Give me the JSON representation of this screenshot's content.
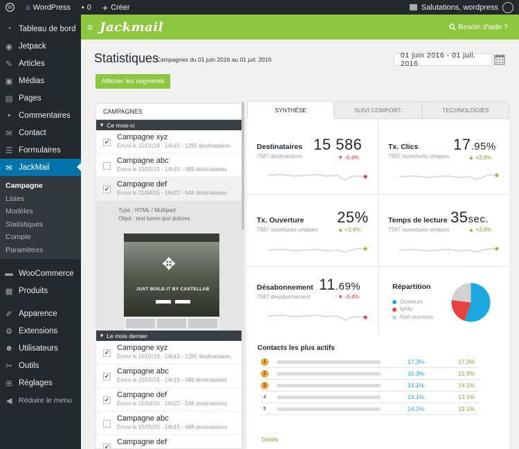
{
  "adminbar": {
    "site": "WordPress",
    "comments": "0",
    "new": "Créer",
    "greeting": "Salutations, wordpress"
  },
  "sidebar": {
    "items": [
      {
        "label": "Tableau de bord",
        "icon": "dashboard-icon"
      },
      {
        "label": "Jetpack",
        "icon": "jetpack-icon"
      },
      {
        "label": "Articles",
        "icon": "pin-icon"
      },
      {
        "label": "Médias",
        "icon": "media-icon"
      },
      {
        "label": "Pages",
        "icon": "pages-icon"
      },
      {
        "label": "Commentaires",
        "icon": "comments-icon"
      },
      {
        "label": "Contact",
        "icon": "mail-icon"
      },
      {
        "label": "Formulaires",
        "icon": "forms-icon"
      },
      {
        "label": "JackMail",
        "icon": "envelope-icon"
      }
    ],
    "submenu": [
      "Campagne",
      "Listes",
      "Modèles",
      "Statistiques",
      "Compte",
      "Paramètres"
    ],
    "items2": [
      {
        "label": "WooCommerce",
        "icon": "woo-icon"
      },
      {
        "label": "Produits",
        "icon": "products-icon"
      }
    ],
    "items3": [
      {
        "label": "Apparence",
        "icon": "brush-icon"
      },
      {
        "label": "Extensions",
        "icon": "plugin-icon"
      },
      {
        "label": "Utilisateurs",
        "icon": "users-icon"
      },
      {
        "label": "Outils",
        "icon": "wrench-icon"
      },
      {
        "label": "Réglages",
        "icon": "settings-icon"
      },
      {
        "label": "Réduire le menu",
        "icon": "collapse-icon"
      }
    ]
  },
  "topbar": {
    "logo": "Jackmail",
    "help": "Besoin d'aide ?"
  },
  "header": {
    "title": "Statistiques",
    "subtitle": "Campagnes du 01 juin 2016 au 01 juil. 2016",
    "date_range": "01 juin 2016 - 01 juil. 2016",
    "segments_button": "Afficher les segments"
  },
  "campaigns": {
    "heading": "CAMPAGNES",
    "group1": "Ce mois-ci",
    "group2": "Le mois dernier",
    "rows1": [
      {
        "name": "Campagne xyz",
        "info": "Envoi le 15/01/16 - 14h15 - 1265 destinataires",
        "checked": "✔"
      },
      {
        "name": "Campagne abc",
        "info": "Envoi le 15/05/15 - 14h15 - 488 destinataires",
        "checked": ""
      },
      {
        "name": "Campagne def",
        "info": "Envoi le 21/04/15 - 16h22 - 548 destinataires",
        "checked": "✔"
      }
    ],
    "detail": {
      "type": "Type : HTML / Multipart",
      "objet": "Objet : test lorem ipsl dolores",
      "preview_text": "JUST BUILD IT BY CASTELLAB"
    },
    "rows2": [
      {
        "name": "Campagne xyz",
        "info": "Envoi le 15/01/16 - 14h15 - 1265 destinataires",
        "checked": "✔"
      },
      {
        "name": "Campagne abc",
        "info": "Envoi le 15/05/15 - 14h15 - 488 destinataires",
        "checked": "✔"
      },
      {
        "name": "Campagne def",
        "info": "Envoi le 21/04/15 - 16h22 - 548 destinataires",
        "checked": "✔"
      },
      {
        "name": "Campagne abc",
        "info": "Envoi le 15/05/15 - 14h15 - 488 destinataires",
        "checked": ""
      },
      {
        "name": "Campagne def",
        "info": "Envoi le 21/04/15 - 16h22 - 548 destinataires",
        "checked": "✔"
      }
    ]
  },
  "tabs": [
    "SYNTHÈSE",
    "SUIVI COMPORT.",
    "TECHNOLOGIES"
  ],
  "stats": {
    "destinataires": {
      "label": "Destinataires",
      "sub": "7587 destinataires",
      "value": "15 586",
      "delta": "-0,4%"
    },
    "clics": {
      "label": "Tx. Clics",
      "sub": "7587 ouvertures uniques",
      "value_main": "17",
      "value_dec": ".95%",
      "delta": "+3,9%"
    },
    "ouverture": {
      "label": "Tx. Ouverture",
      "sub": "7587 ouvertures uniques",
      "value": "25%",
      "delta": "+3,4%"
    },
    "lecture": {
      "label": "Temps de lecture",
      "sub": "7587 ouvertures uniques",
      "value_main": "35",
      "value_unit": "sec.",
      "delta": "+3,4%"
    },
    "desabonnement": {
      "label": "Désabonnement",
      "sub": "7587 désabonnement",
      "value_main": "11",
      "value_dec": ".69%",
      "delta": "-0,4%"
    },
    "repartition": {
      "label": "Répartition",
      "legend": [
        "Ouvreurs",
        "NPAI",
        "Non ouvreurs"
      ],
      "colors": [
        "#1aa8e0",
        "#e8423f",
        "#d0d0d0"
      ],
      "shares": [
        0.55,
        0.22,
        0.23
      ]
    }
  },
  "contacts": {
    "heading": "Contacts les plus actifs",
    "rows": [
      {
        "rank": "1",
        "p1": "17.3%",
        "p2": "17.3%"
      },
      {
        "rank": "2",
        "p1": "15.3%",
        "p2": "15.3%"
      },
      {
        "rank": "3",
        "p1": "14.1%",
        "p2": "14.1%"
      },
      {
        "rank": "4",
        "p1": "14.1%",
        "p2": "13.1%"
      },
      {
        "rank": "5",
        "p1": "14.1%",
        "p2": "12.1%"
      }
    ],
    "link": "Détails"
  }
}
